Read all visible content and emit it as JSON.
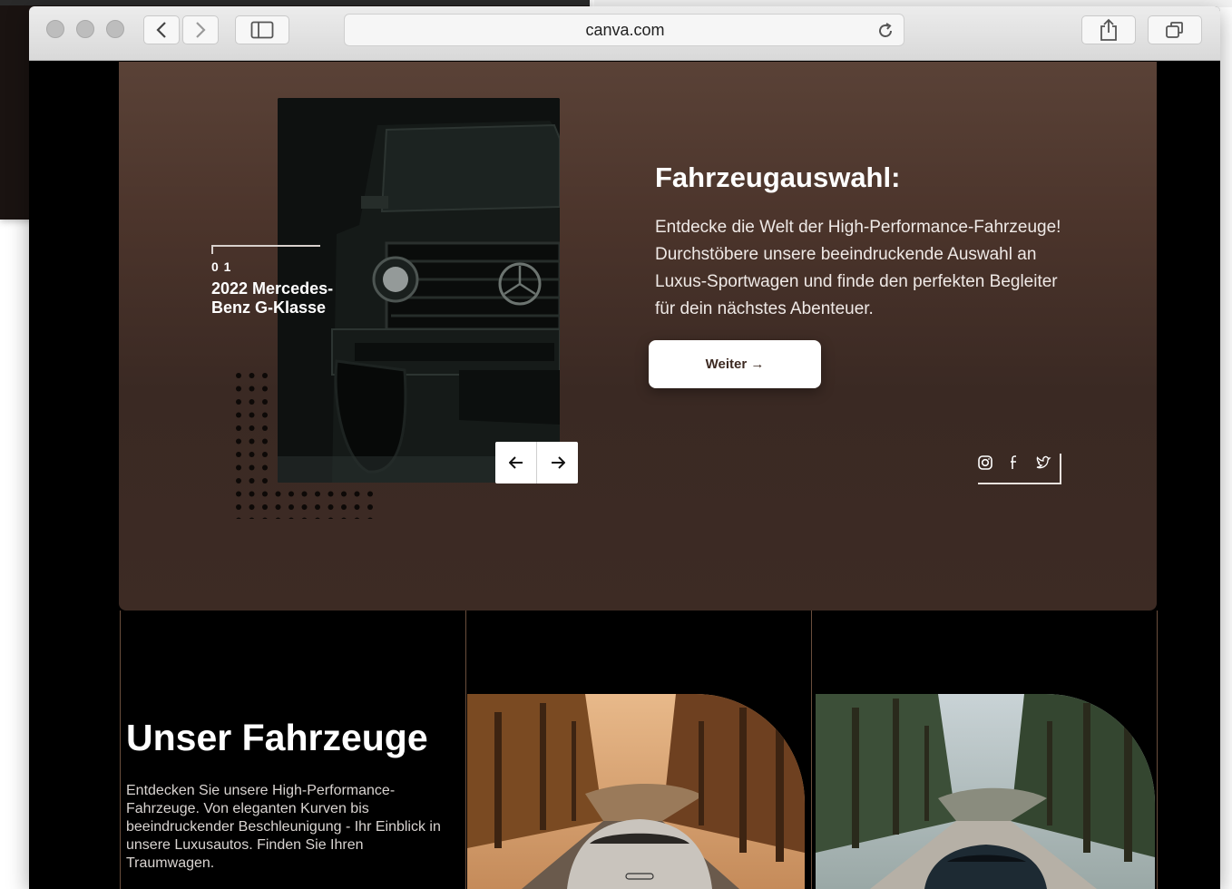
{
  "browser": {
    "url": "canva.com"
  },
  "hero": {
    "index": "0 1",
    "car_name": "2022 Mercedes-Benz G-Klasse",
    "title": "Fahrzeugauswahl:",
    "text": "Entdecke die Welt der High-Performance-Fahrzeuge! Durchstöbere unsere beeindruckende Auswahl an Luxus-Sportwagen und finde den perfekten Begleiter für dein nächstes Abenteuer.",
    "button_label": "Weiter →",
    "prev_arrow": "←",
    "next_arrow": "→",
    "social_icons": [
      "instagram-icon",
      "facebook-icon",
      "twitter-icon"
    ]
  },
  "vehicles": {
    "title": "Unser Fahrzeuge",
    "text": "Entdecken Sie unsere High-Performance-Fahrzeuge. Von eleganten Kurven bis beeindruckender Beschleunigung - Ihr Einblick in unsere Luxusautos. Finden Sie Ihren Traumwagen."
  },
  "colors": {
    "hero_top": "#5a4237",
    "hero_bottom": "#3d2b24",
    "page_background": "#000000",
    "column_divider": "#6a4e3c"
  }
}
